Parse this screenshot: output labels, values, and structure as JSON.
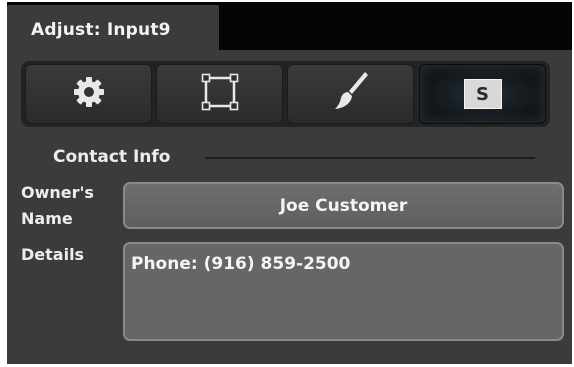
{
  "panel": {
    "title": "Adjust: Input9"
  },
  "toolbar": {
    "tabs": [
      {
        "name": "settings",
        "icon": "gear-icon",
        "active": false
      },
      {
        "name": "transform",
        "icon": "crop-icon",
        "active": false
      },
      {
        "name": "style",
        "icon": "brush-icon",
        "active": false
      },
      {
        "name": "script",
        "icon": "s-badge-icon",
        "label": "S",
        "active": true
      }
    ]
  },
  "contact": {
    "section_title": "Contact Info",
    "owner_label_line1": "Owner's",
    "owner_label_line2": "Name",
    "owner_value": "Joe Customer",
    "details_label": "Details",
    "details_value": "Phone: (916) 859-2500"
  },
  "colors": {
    "panel_bg": "#3b3b3b",
    "header_bg": "#050505",
    "active_tab_glow": "#6aa8c8",
    "field_bg": "#666666"
  }
}
